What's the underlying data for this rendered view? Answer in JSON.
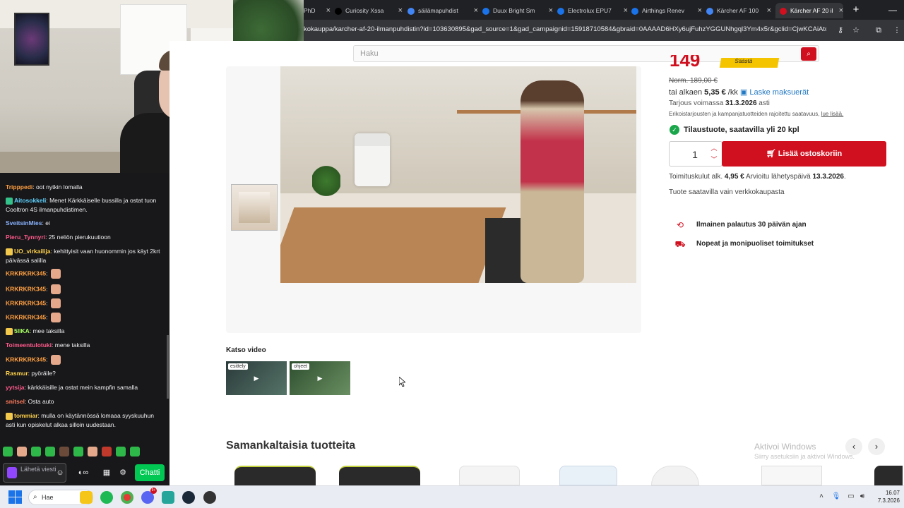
{
  "browser": {
    "tabs": [
      {
        "label": "PhD",
        "color": "#9e9e9e"
      },
      {
        "label": "Curiosity Xssa",
        "color": "#000000"
      },
      {
        "label": "säilämapuhdist",
        "color": "#4285f4"
      },
      {
        "label": "Duux Bright Sm",
        "color": "#1a73e8"
      },
      {
        "label": "Electrolux EPU7",
        "color": "#1a73e8"
      },
      {
        "label": "Airthings Renev",
        "color": "#1a73e8"
      },
      {
        "label": "Kärcher AF 100",
        "color": "#4285f4"
      },
      {
        "label": "Kärcher AF 20 il",
        "color": "#d0101f"
      }
    ],
    "url": "kokauppa/karcher-af-20-ilmanpuhdistin?id=103630895&gad_source=1&gad_campaignid=15918710584&gbraid=0AAAAD6HXy6ujFuhzYGGUNhgql3Ym4x5r&gclid=CjwKCAiAtq_..."
  },
  "chat": {
    "messages": [
      {
        "user": "Tripppedi",
        "text": ": oot nytkin lomalla",
        "color": "#ff9f40",
        "badge": ""
      },
      {
        "user": "Aitosokkeli",
        "text": ": Menet Kärkkäiselle bussilla ja ostat tuon Cooltron 4S ilmanpuhdistimen.",
        "color": "#5fd3ff",
        "badge": "#35c28a"
      },
      {
        "user": "SveitsinMies",
        "text": ": ei",
        "color": "#8ab4ff",
        "badge": ""
      },
      {
        "user": "Pieru_Tynnyri",
        "text": ": 25 neliön pierukuutioon",
        "color": "#ff5a8a",
        "badge": ""
      },
      {
        "user": "UO_virkailija",
        "text": ": kehittyisit vaan huonommin jos käyt 2krt päivässä salilla",
        "color": "#ffd24a",
        "badge": "#f2c94c"
      },
      {
        "user": "KRKRKRK345",
        "text": ":",
        "color": "#ff9f40",
        "badge": "",
        "emote": true
      },
      {
        "user": "KRKRKRK345",
        "text": ":",
        "color": "#ff9f40",
        "badge": "",
        "emote": true
      },
      {
        "user": "KRKRKRK345",
        "text": ":",
        "color": "#ff9f40",
        "badge": "",
        "emote": true
      },
      {
        "user": "KRKRKRK345",
        "text": ":",
        "color": "#ff9f40",
        "badge": "",
        "emote": true
      },
      {
        "user": "5IIKA",
        "text": ": mee taksilla",
        "color": "#a8ff60",
        "badge": "#f2c94c"
      },
      {
        "user": "Toimeentulotuki",
        "text": ": mene taksilla",
        "color": "#ff5a8a",
        "badge": ""
      },
      {
        "user": "KRKRKRK345",
        "text": ":",
        "color": "#ff9f40",
        "badge": "",
        "emote": true
      },
      {
        "user": "Rasmur",
        "text": ": pyöräile?",
        "color": "#ffd24a",
        "badge": ""
      },
      {
        "user": "yytsija",
        "text": ": kärkkäisille ja ostat mein kampfin samalla",
        "color": "#ff5a8a",
        "badge": ""
      },
      {
        "user": "snitsel",
        "text": ": Osta auto",
        "color": "#ff7a5a",
        "badge": ""
      },
      {
        "user": "tommiar",
        "text": ": mulla on käytännössä lomaaa syyskuuhun asti kun opiskelut alkaa silloin uudestaan.",
        "color": "#ffd24a",
        "badge": "#f2c94c"
      }
    ],
    "input_placeholder": "Lähetä viesti",
    "send_label": "Chatti"
  },
  "page": {
    "search_placeholder": "Haku",
    "price_big": "149",
    "tag_text": "Säästä",
    "norm_price": "Norm. 189,00 €",
    "installment_prefix": "tai alkaen ",
    "installment_value": "5,35 €",
    "installment_suffix": " /kk ",
    "calc_link": "Laske maksuerät",
    "offer_prefix": "Tarjous voimassa ",
    "offer_date": "31.3.2026",
    "offer_suffix": " asti",
    "disclaimer": "Erikoistarjousten ja kampanjatuotteiden rajoitettu saatavuus, ",
    "disclaimer_link": "lue lisää.",
    "stock_text": "Tilaustuote, saatavilla yli 20 kpl",
    "quantity": "1",
    "cart_button": "Lisää ostoskoriin",
    "shipping_prefix": "Toimituskulut alk. ",
    "shipping_cost": "4,95 €",
    "shipping_mid": " Arvioitu lähetyspäivä ",
    "shipping_date": "13.3.2026",
    "shipping_end": ".",
    "online_only": "Tuote saatavilla vain verkkokaupasta",
    "features": [
      {
        "text": "Ilmainen palautus 30 päivän ajan",
        "icon": "return-30-icon"
      },
      {
        "text": "Nopeat ja monipuoliset toimitukset",
        "icon": "delivery-truck-icon"
      }
    ],
    "video_title": "Katso video",
    "videos": [
      {
        "label": "esittely"
      },
      {
        "label": "ohjeet"
      }
    ],
    "similar_title": "Samankaltaisia tuotteita",
    "watermark_title": "Aktivoi Windows",
    "watermark_sub": "Siirry asetuksiin ja aktivoi Windows."
  },
  "taskbar": {
    "search_label": "Hae",
    "notification_count": "9+",
    "time": "16.07",
    "date": "7.3.2026"
  },
  "colors": {
    "brand_red": "#d0101f",
    "stock_green": "#1aa64a",
    "chat_bg": "#18181b",
    "link_blue": "#2178c4"
  }
}
